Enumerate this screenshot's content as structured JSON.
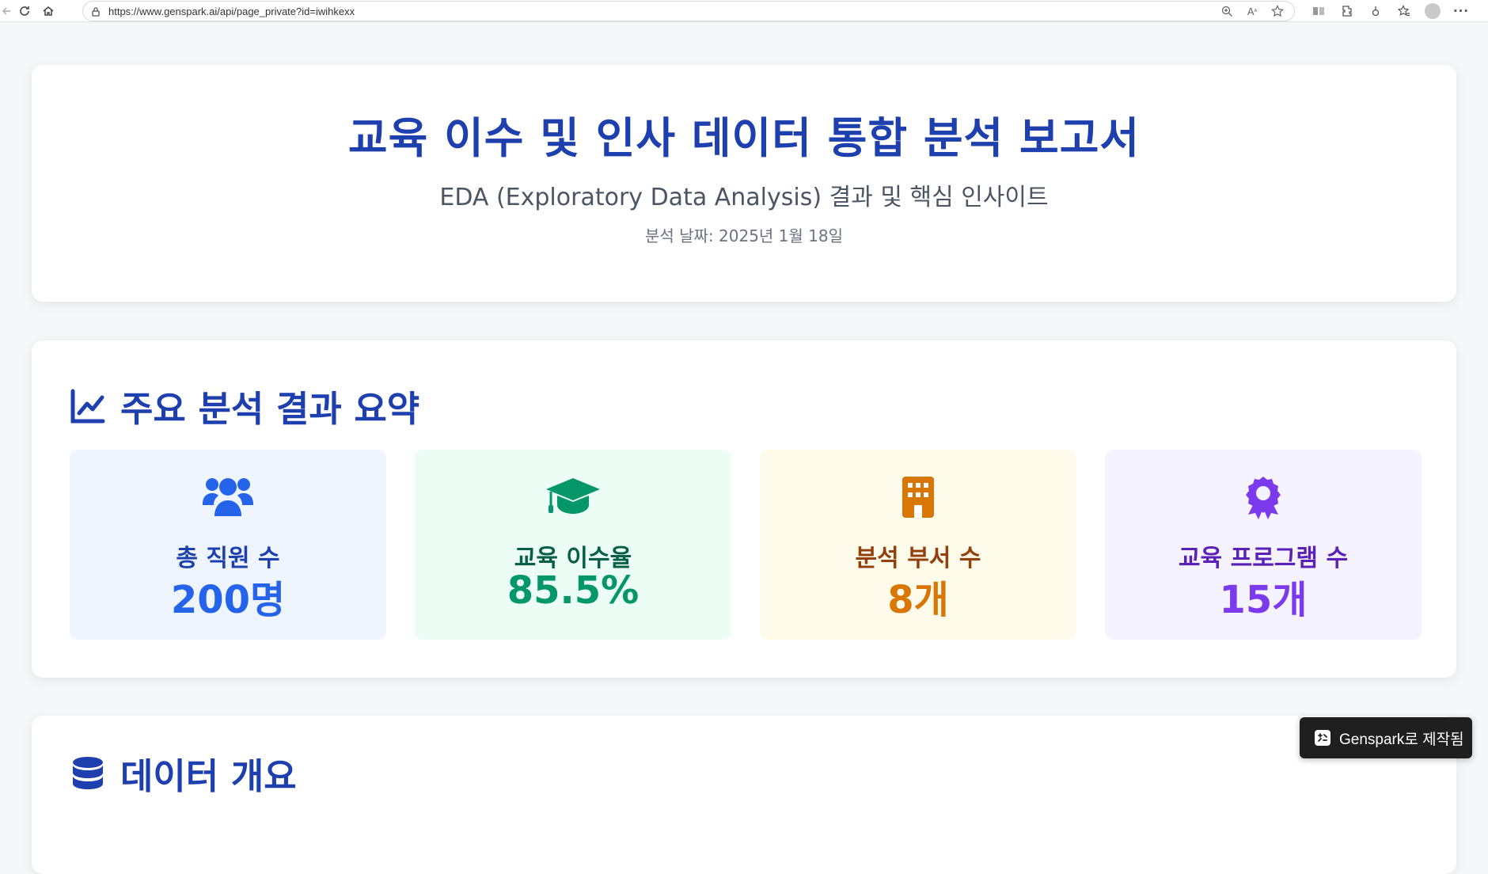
{
  "browser": {
    "url": "https://www.genspark.ai/api/page_private?id=iwihkexx"
  },
  "header": {
    "title": "교육 이수 및 인사 데이터 통합 분석 보고서",
    "subtitle": "EDA (Exploratory Data Analysis) 결과 및 핵심 인사이트",
    "date": "분석 날짜: 2025년 1월 18일"
  },
  "summary": {
    "title": "주요 분석 결과 요약",
    "stats": [
      {
        "label": "총 직원 수",
        "value": "200명",
        "icon": "users-icon",
        "color": "#2563eb"
      },
      {
        "label": "교육 이수율",
        "value": "85.5%",
        "icon": "graduation-cap-icon",
        "color": "#059669"
      },
      {
        "label": "분석 부서 수",
        "value": "8개",
        "icon": "building-icon",
        "color": "#d97706"
      },
      {
        "label": "교육 프로그램 수",
        "value": "15개",
        "icon": "award-icon",
        "color": "#7c3aed"
      }
    ]
  },
  "overview": {
    "title": "데이터 개요"
  },
  "badge": {
    "label": "Genspark로 제작됨"
  },
  "colors": {
    "accent": "#1e40af"
  }
}
